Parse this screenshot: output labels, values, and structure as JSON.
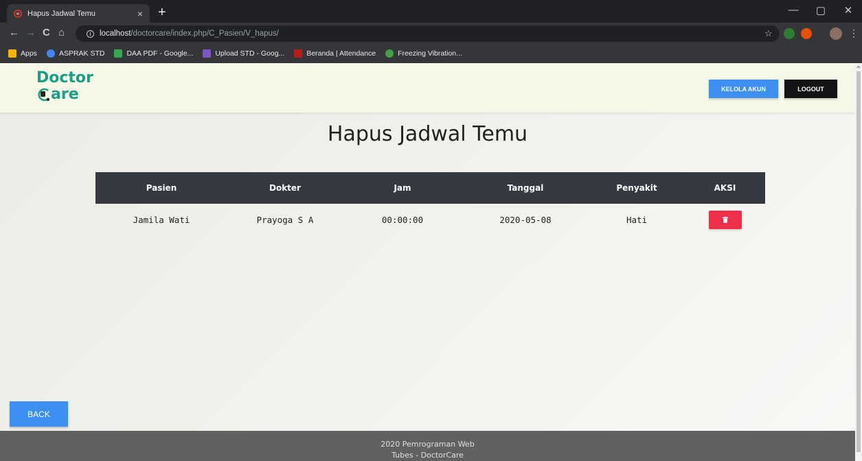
{
  "browser": {
    "tab_title": "Hapus Jadwal Temu",
    "tab_close": "×",
    "new_tab": "+",
    "url_host": "localhost",
    "url_path": "/doctorcare/index.php/C_Pasien/V_hapus/",
    "window_controls": {
      "minimize": "—",
      "maximize": "▢",
      "close": "✕"
    },
    "nav": {
      "back": "←",
      "forward": "→",
      "reload": "C",
      "home": "⌂"
    },
    "bookmarks": [
      {
        "label": "Apps",
        "color": "#f4b400"
      },
      {
        "label": "ASPRAK STD",
        "color": "#4285f4"
      },
      {
        "label": "DAA PDF - Google...",
        "color": "#34a853"
      },
      {
        "label": "Upload STD - Goog...",
        "color": "#7e57c2"
      },
      {
        "label": "Beranda | Attendance",
        "color": "#b71c1c"
      },
      {
        "label": "Freezing Vibration...",
        "color": "#43a047"
      }
    ]
  },
  "header": {
    "logo_line1": "Doctor",
    "logo_line2": "are",
    "kelola_label": "KELOLA AKUN",
    "logout_label": "LOGOUT",
    "accent": "#1d9e86"
  },
  "page": {
    "title": "Hapus Jadwal Temu"
  },
  "table": {
    "headers": [
      "Pasien",
      "Dokter",
      "Jam",
      "Tanggal",
      "Penyakit",
      "AKSI"
    ],
    "rows": [
      {
        "pasien": "Jamila Wati",
        "dokter": "Prayoga S A",
        "jam": "00:00:00",
        "tanggal": "2020-05-08",
        "penyakit": "Hati"
      }
    ]
  },
  "back_label": "BACK",
  "footer": {
    "line1": "2020 Pemrograman Web",
    "line2": "Tubes - DoctorCare"
  },
  "colors": {
    "primary_button": "#3d8ff1",
    "delete_button": "#f0304a",
    "table_header": "#343a40",
    "footer": "#616161"
  }
}
